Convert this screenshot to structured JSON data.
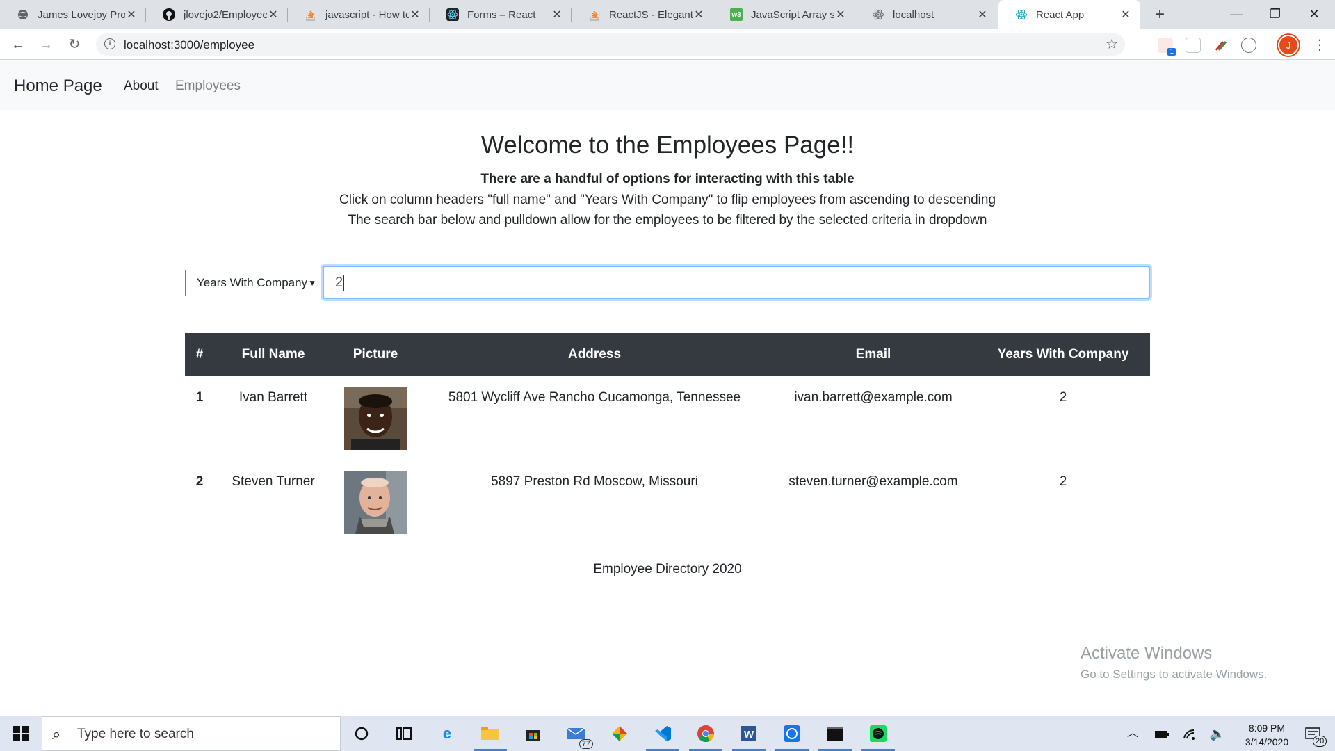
{
  "browser": {
    "tabs": [
      {
        "title": "James Lovejoy Pro",
        "icon": "globe-icon"
      },
      {
        "title": "jlovejo2/Employee",
        "icon": "github-icon"
      },
      {
        "title": "javascript - How to",
        "icon": "stackoverflow-icon"
      },
      {
        "title": "Forms – React",
        "icon": "react-icon"
      },
      {
        "title": "ReactJS - Elegant w",
        "icon": "stackoverflow-icon"
      },
      {
        "title": "JavaScript Array sc",
        "icon": "w3schools-icon"
      },
      {
        "title": "localhost",
        "icon": "react-icon"
      },
      {
        "title": "React App",
        "icon": "react-icon"
      }
    ],
    "url": "localhost:3000/employee",
    "profile_initial": "J",
    "extension_badge": "1"
  },
  "navbar": {
    "brand": "Home Page",
    "links": [
      {
        "label": "About"
      },
      {
        "label": "Employees"
      }
    ]
  },
  "page": {
    "heading": "Welcome to the Employees Page!!",
    "intro_bold": "There are a handful of options for interacting with this table",
    "intro_line1": "Click on column headers \"full name\" and \"Years With Company\" to flip employees from ascending to descending",
    "intro_line2": "The search bar below and pulldown allow for the employees to be filtered by the selected criteria in dropdown"
  },
  "filter": {
    "selected_option": "Years With Company",
    "search_value": "2"
  },
  "table": {
    "headers": [
      "#",
      "Full Name",
      "Picture",
      "Address",
      "Email",
      "Years With Company"
    ],
    "rows": [
      {
        "num": "1",
        "name": "Ivan Barrett",
        "address": "5801 Wycliff Ave Rancho Cucamonga, Tennessee",
        "email": "ivan.barrett@example.com",
        "years": "2"
      },
      {
        "num": "2",
        "name": "Steven Turner",
        "address": "5897 Preston Rd Moscow, Missouri",
        "email": "steven.turner@example.com",
        "years": "2"
      }
    ]
  },
  "footer": "Employee Directory 2020",
  "watermark": {
    "title": "Activate Windows",
    "subtitle": "Go to Settings to activate Windows."
  },
  "taskbar": {
    "search_placeholder": "Type here to search",
    "mail_badge": "77",
    "time": "8:09 PM",
    "date": "3/14/2020",
    "notification_count": "20"
  }
}
